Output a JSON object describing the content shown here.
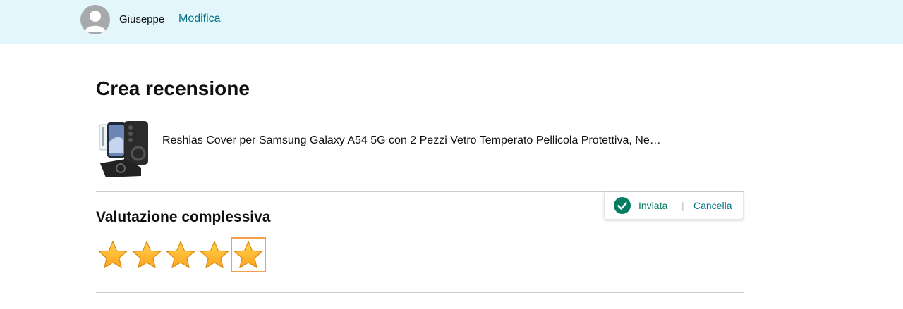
{
  "header": {
    "user_name": "Giuseppe",
    "edit_label": "Modifica",
    "avatar_icon": "user-avatar-icon"
  },
  "page": {
    "title": "Crea recensione"
  },
  "product": {
    "title": "Reshias Cover per Samsung Galaxy A54 5G con 2 Pezzi Vetro Temperato Pellicola Protettiva, Ne…",
    "image_icon": "phone-case-product-image"
  },
  "status": {
    "text": "Inviata",
    "separator": "|",
    "cancel_label": "Cancella",
    "icon": "check-circle-icon"
  },
  "rating": {
    "heading": "Valutazione complessiva",
    "value": 5,
    "max": 5,
    "focused_star": 5
  },
  "colors": {
    "top_bar": "#e3f6fb",
    "link": "#007185",
    "success": "#067d62",
    "star_fill": "#ffa41c",
    "focus_ring": "#f49f4a"
  }
}
